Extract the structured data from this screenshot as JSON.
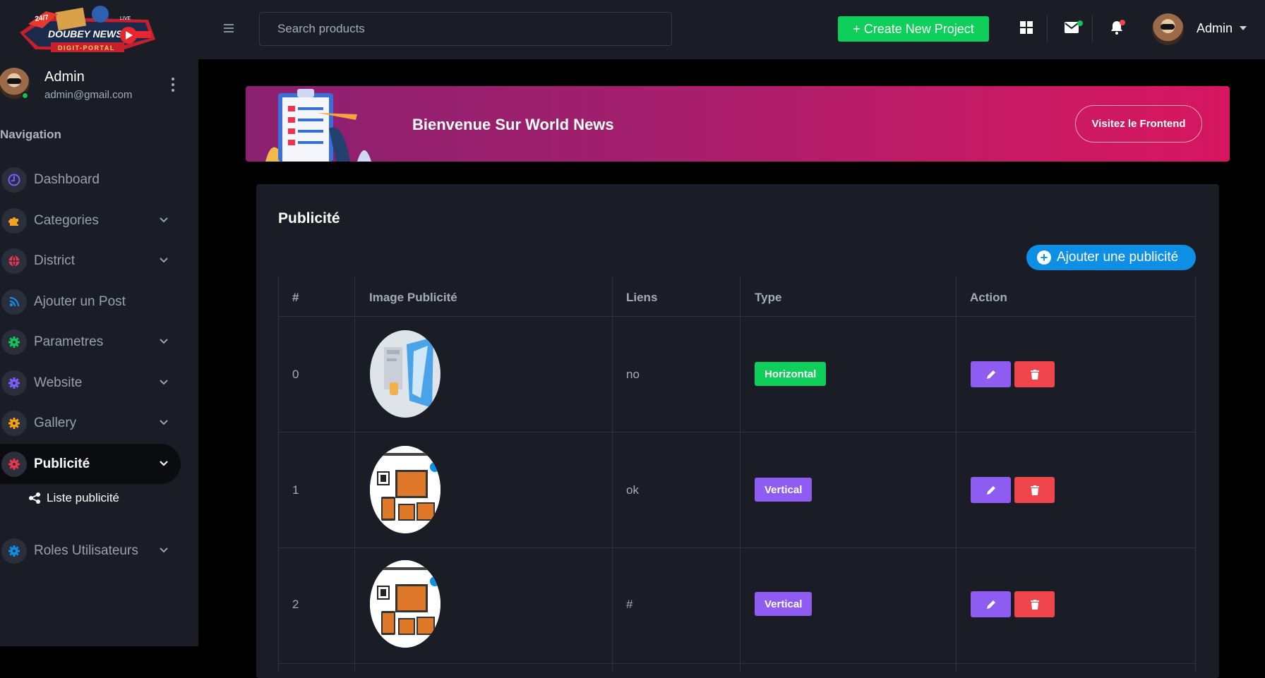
{
  "brand": {
    "logo_line1": "24/7",
    "logo_name": "DOUBEY NEWS",
    "logo_live": "LIVE",
    "logo_sub": "DIGIT-PORTAL"
  },
  "sidebar": {
    "user_name": "Admin",
    "user_email": "admin@gmail.com",
    "nav_heading": "Navigation",
    "items": [
      {
        "label": "Dashboard",
        "icon": "dashboard-icon",
        "color": "#7c5cff",
        "has_chevron": false
      },
      {
        "label": "Categories",
        "icon": "puzzle-icon",
        "color": "#f7a21b",
        "has_chevron": true
      },
      {
        "label": "District",
        "icon": "globe-icon",
        "color": "#e8374b",
        "has_chevron": true
      },
      {
        "label": "Ajouter un Post",
        "icon": "rss-icon",
        "color": "#0d8fe6",
        "has_chevron": false
      },
      {
        "label": "Parametres",
        "icon": "gear-icon",
        "color": "#14c45a",
        "has_chevron": true
      },
      {
        "label": "Website",
        "icon": "gear-icon",
        "color": "#7c5cff",
        "has_chevron": true
      },
      {
        "label": "Gallery",
        "icon": "gear-icon",
        "color": "#f7a21b",
        "has_chevron": true
      },
      {
        "label": "Publicité",
        "icon": "gear-icon",
        "color": "#e8374b",
        "has_chevron": true
      },
      {
        "label": "Roles Utilisateurs",
        "icon": "gear-icon",
        "color": "#0d8fe6",
        "has_chevron": true
      }
    ],
    "sub_item": "Liste publicité"
  },
  "topbar": {
    "search_placeholder": "Search products",
    "create_label": "+ Create New Project",
    "admin_label": "Admin"
  },
  "banner": {
    "title": "Bienvenue Sur World News",
    "button": "Visitez le Frontend"
  },
  "card": {
    "title": "Publicité",
    "add_button": "Ajouter une publicité",
    "columns": [
      "#",
      "Image Publicité",
      "Liens",
      "Type",
      "Action"
    ],
    "rows": [
      {
        "index": "0",
        "link": "no",
        "type": "Horizontal",
        "type_color": "#0fcf5b"
      },
      {
        "index": "1",
        "link": "ok",
        "type": "Vertical",
        "type_color": "#8e5cf0"
      },
      {
        "index": "2",
        "link": "#",
        "type": "Vertical",
        "type_color": "#8e5cf0"
      }
    ]
  },
  "colors": {
    "edit": "#8e5cf0",
    "delete": "#f0454d",
    "accent": "#0d8fe6",
    "success": "#0fcf5b"
  }
}
